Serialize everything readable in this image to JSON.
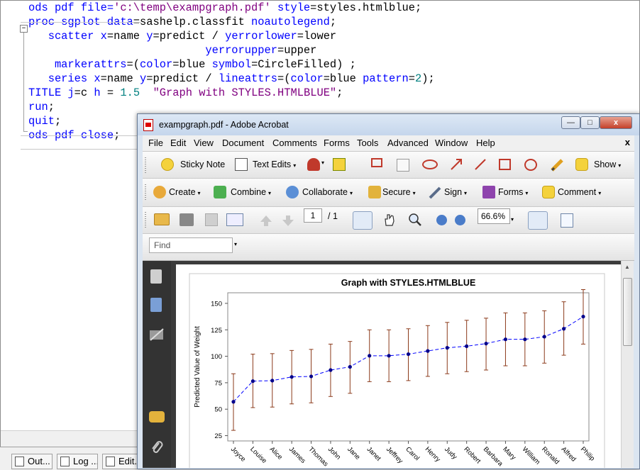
{
  "editor": {
    "lines": [
      [
        {
          "t": "ods pdf file=",
          "c": "kw"
        },
        {
          "t": "'c:\\temp\\exampgraph.pdf'",
          "c": "str"
        },
        {
          "t": " style",
          "c": "kw"
        },
        {
          "t": "=styles.htmlblue;",
          "c": "cmt"
        }
      ],
      [
        {
          "t": "proc sgplot ",
          "c": "kw"
        },
        {
          "t": "data",
          "c": "kw"
        },
        {
          "t": "=sashelp.classfit ",
          "c": "cmt"
        },
        {
          "t": "noautolegend",
          "c": "kw"
        },
        {
          "t": ";",
          "c": "cmt"
        }
      ],
      [
        {
          "t": "   scatter ",
          "c": "kw"
        },
        {
          "t": "x",
          "c": "kw"
        },
        {
          "t": "=name ",
          "c": "cmt"
        },
        {
          "t": "y",
          "c": "kw"
        },
        {
          "t": "=predict / ",
          "c": "cmt"
        },
        {
          "t": "yerrorlower",
          "c": "kw"
        },
        {
          "t": "=lower",
          "c": "cmt"
        }
      ],
      [
        {
          "t": "                           yerrorupper",
          "c": "kw"
        },
        {
          "t": "=upper",
          "c": "cmt"
        }
      ],
      [
        {
          "t": "    markerattrs",
          "c": "kw"
        },
        {
          "t": "=(",
          "c": "cmt"
        },
        {
          "t": "color",
          "c": "kw"
        },
        {
          "t": "=blue ",
          "c": "cmt"
        },
        {
          "t": "symbol",
          "c": "kw"
        },
        {
          "t": "=CircleFilled) ;",
          "c": "cmt"
        }
      ],
      [
        {
          "t": "   series ",
          "c": "kw"
        },
        {
          "t": "x",
          "c": "kw"
        },
        {
          "t": "=name ",
          "c": "cmt"
        },
        {
          "t": "y",
          "c": "kw"
        },
        {
          "t": "=predict / ",
          "c": "cmt"
        },
        {
          "t": "lineattrs",
          "c": "kw"
        },
        {
          "t": "=(",
          "c": "cmt"
        },
        {
          "t": "color",
          "c": "kw"
        },
        {
          "t": "=blue ",
          "c": "cmt"
        },
        {
          "t": "pattern",
          "c": "kw"
        },
        {
          "t": "=",
          "c": "cmt"
        },
        {
          "t": "2",
          "c": "num"
        },
        {
          "t": ");",
          "c": "cmt"
        }
      ],
      [
        {
          "t": "TITLE ",
          "c": "kw"
        },
        {
          "t": "j",
          "c": "kw"
        },
        {
          "t": "=c ",
          "c": "cmt"
        },
        {
          "t": "h",
          "c": "kw"
        },
        {
          "t": " = ",
          "c": "cmt"
        },
        {
          "t": "1.5",
          "c": "num"
        },
        {
          "t": "  ",
          "c": "cmt"
        },
        {
          "t": "\"Graph with STYLES.HTMLBLUE\"",
          "c": "str"
        },
        {
          "t": ";",
          "c": "cmt"
        }
      ],
      [
        {
          "t": "run",
          "c": "kw"
        },
        {
          "t": ";",
          "c": "cmt"
        }
      ],
      [
        {
          "t": "quit",
          "c": "kw"
        },
        {
          "t": ";",
          "c": "cmt"
        }
      ],
      [
        {
          "t": "ods pdf close",
          "c": "kw"
        },
        {
          "t": ";",
          "c": "cmt"
        }
      ]
    ],
    "fold_symbol": "−"
  },
  "taskbar": {
    "items": [
      {
        "label": "Out..."
      },
      {
        "label": "Log ..."
      },
      {
        "label": "Edit..."
      }
    ]
  },
  "acrobat": {
    "title": "exampgraph.pdf - Adobe Acrobat",
    "window_buttons": {
      "minimize": "—",
      "maximize": "□",
      "close": "x"
    },
    "menu": [
      "File",
      "Edit",
      "View",
      "Document",
      "Comments",
      "Forms",
      "Tools",
      "Advanced",
      "Window",
      "Help"
    ],
    "menu_close": "x",
    "toolbar1": {
      "sticky_note": "Sticky Note",
      "text_edits": "Text Edits",
      "show": "Show"
    },
    "toolbar2": {
      "create": "Create",
      "combine": "Combine",
      "collaborate": "Collaborate",
      "secure": "Secure",
      "sign": "Sign",
      "forms": "Forms",
      "comment": "Comment"
    },
    "toolbar3": {
      "page_number": "1",
      "page_total": "/ 1",
      "zoom": "66.6%"
    },
    "find_placeholder": "Find",
    "dropdown_glyph": "▾"
  },
  "chart_data": {
    "type": "scatter",
    "title": "Graph with STYLES.HTMLBLUE",
    "xlabel": "",
    "ylabel": "Predicted Value of Weight",
    "yticks": [
      25,
      50,
      75,
      100,
      125,
      150
    ],
    "ylim": [
      20,
      160
    ],
    "categories": [
      "Joyce",
      "Louise",
      "Alice",
      "James",
      "Thomas",
      "John",
      "Jane",
      "Janet",
      "Jeffrey",
      "Carol",
      "Henry",
      "Judy",
      "Robert",
      "Barbara",
      "Mary",
      "William",
      "Ronald",
      "Alfred",
      "Philip"
    ],
    "series": [
      {
        "values": [
          57,
          76.5,
          77,
          80.5,
          81,
          87,
          90,
          100.5,
          100.5,
          102,
          105,
          108,
          109.5,
          112,
          116,
          116,
          118.5,
          126,
          137.5
        ],
        "lower": [
          30,
          51.5,
          52,
          55,
          56,
          62,
          65,
          76,
          76,
          77,
          81,
          83.5,
          85.5,
          87,
          91,
          91,
          93.5,
          101,
          111.5
        ],
        "upper": [
          83.5,
          102,
          102.5,
          105.5,
          106.5,
          111.5,
          114,
          125,
          125,
          126,
          129,
          132,
          134,
          136,
          141,
          141,
          143,
          151.5,
          163
        ]
      }
    ],
    "colors": {
      "marker": "#00008b",
      "line": "#0000ff",
      "error_bar": "#8b3a1a"
    }
  }
}
